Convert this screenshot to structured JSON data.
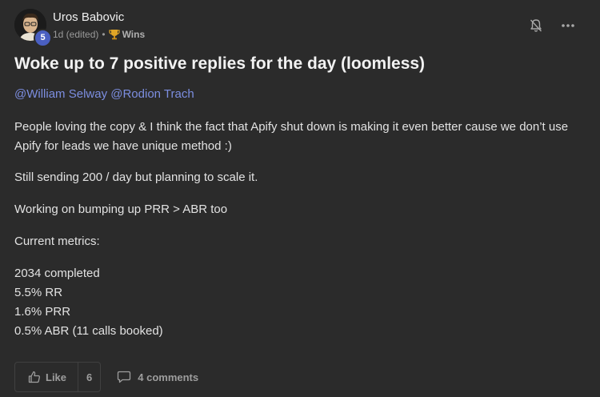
{
  "author": {
    "name": "Uros Babovic",
    "level": "5",
    "avatar_icon": "avatar-icon"
  },
  "meta": {
    "time": "1d (edited)",
    "separator": "•",
    "category": "Wins",
    "category_icon": "trophy-icon"
  },
  "header_actions": {
    "bell_icon": "bell-off-icon",
    "more_icon": "more-horizontal-icon"
  },
  "post": {
    "title": "Woke up to 7 positive replies for the day (loomless)",
    "mentions": [
      "@William Selway",
      "@Rodion Trach"
    ],
    "paragraphs": [
      "People loving the copy & I think the fact that Apify shut down is making it even better cause we don’t use Apify for leads we have unique method :)",
      "Still sending 200 / day but planning to scale it.",
      "Working on bumping up PRR > ABR too",
      "Current metrics:"
    ],
    "metrics": [
      "2034 completed",
      "5.5% RR",
      "1.6% PRR",
      "0.5% ABR (11 calls booked)"
    ]
  },
  "actions": {
    "like_label": "Like",
    "like_count": "6",
    "comments_label": "4 comments"
  },
  "colors": {
    "background": "#2b2b2b",
    "mention": "#7c8ee0",
    "level_badge": "#4a5fc1",
    "trophy": "#e0a526"
  }
}
